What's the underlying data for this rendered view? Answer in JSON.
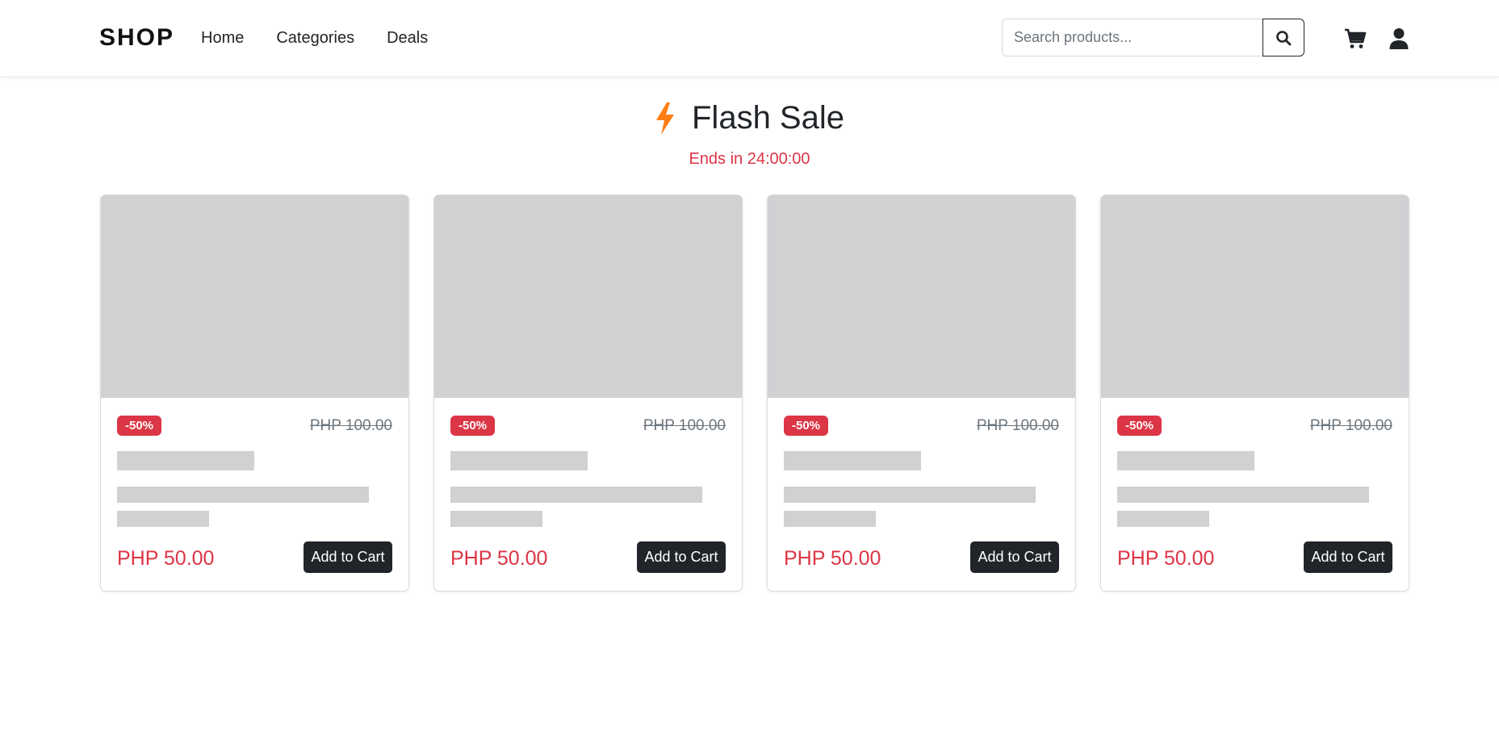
{
  "navbar": {
    "brand": "SHOP",
    "links": [
      "Home",
      "Categories",
      "Deals"
    ],
    "search": {
      "placeholder": "Search products...",
      "value": ""
    },
    "icons": {
      "search": "search-icon",
      "cart": "cart-icon",
      "user": "user-icon"
    }
  },
  "flash_sale": {
    "icon": "lightning-bolt-icon",
    "title": "Flash Sale",
    "timer": "Ends in 24:00:00"
  },
  "products": [
    {
      "discount": "-50%",
      "old_price": "PHP 100.00",
      "price": "PHP 50.00",
      "button": "Add to Cart"
    },
    {
      "discount": "-50%",
      "old_price": "PHP 100.00",
      "price": "PHP 50.00",
      "button": "Add to Cart"
    },
    {
      "discount": "-50%",
      "old_price": "PHP 100.00",
      "price": "PHP 50.00",
      "button": "Add to Cart"
    },
    {
      "discount": "-50%",
      "old_price": "PHP 100.00",
      "price": "PHP 50.00",
      "button": "Add to Cart"
    }
  ],
  "colors": {
    "accent_red": "#dc3545",
    "bolt_orange": "#fd7e14",
    "dark": "#212529",
    "placeholder_gray": "#d0d1d3"
  }
}
